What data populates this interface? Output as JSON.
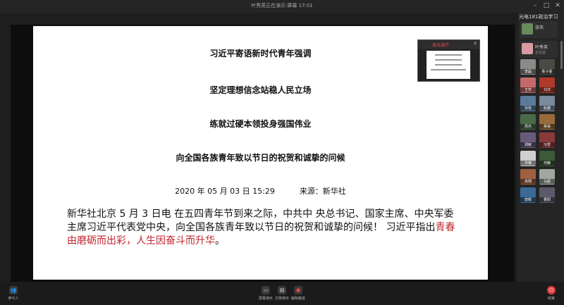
{
  "window": {
    "title": "叶秀英正在演示·屏幕 17:01"
  },
  "slide": {
    "line1": "习近平寄语新时代青年强调",
    "line2": "坚定理想信念站稳人民立场",
    "line3": "练就过硬本领投身强国伟业",
    "line4": "向全国各族青年致以节日的祝贺和诚挚的问候",
    "date": "2020 年 05 月 03 日 15:29",
    "source": "来源：新华社",
    "body_normal": "新华社北京 5 月 3 日电 在五四青年节到来之际，中共中 央总书记、国家主席、中央军委主席习近平代表党中央，向全国各族青年致以节日的祝贺和诚挚的问候！ 习近平指出",
    "body_red": "青春由磨砺而出彩，人生因奋斗而升华",
    "body_end": "。"
  },
  "thumbnail": {
    "label": "退出演示"
  },
  "sidebar": {
    "header": "光电181政治学习",
    "presenter": {
      "name": "张伟",
      "color": "#6a8a5a"
    },
    "speaker": {
      "name": "叶秀英",
      "sub": "正在说",
      "color": "#d99aa0"
    },
    "participants": [
      {
        "name": "李磊",
        "color": "#8a8a88"
      },
      {
        "name": "陈子豪",
        "color": "#4a4a44"
      },
      {
        "name": "王芳",
        "color": "#c46a6a"
      },
      {
        "name": "刘洋",
        "color": "#b03a2a"
      },
      {
        "name": "孙悦",
        "color": "#5a7a9a"
      },
      {
        "name": "赵鑫",
        "color": "#7a8a9a"
      },
      {
        "name": "周杰",
        "color": "#4a6a4a"
      },
      {
        "name": "吴昊",
        "color": "#9a6a3a"
      },
      {
        "name": "郑敏",
        "color": "#6a5a7a"
      },
      {
        "name": "冯雪",
        "color": "#8a3a3a"
      },
      {
        "name": "许琳",
        "color": "#cfcfcf"
      },
      {
        "name": "何静",
        "color": "#3a5a3a"
      },
      {
        "name": "高翔",
        "color": "#a06040"
      },
      {
        "name": "马超",
        "color": "#a0a8a0"
      },
      {
        "name": "唐颖",
        "color": "#3a6a9a"
      },
      {
        "name": "曹阳",
        "color": "#5a5a6a"
      }
    ]
  },
  "bottombar": {
    "members": "参与人",
    "share": "屏幕演示",
    "doc": "文档演示",
    "mic": "解除静音",
    "end": "结束"
  }
}
